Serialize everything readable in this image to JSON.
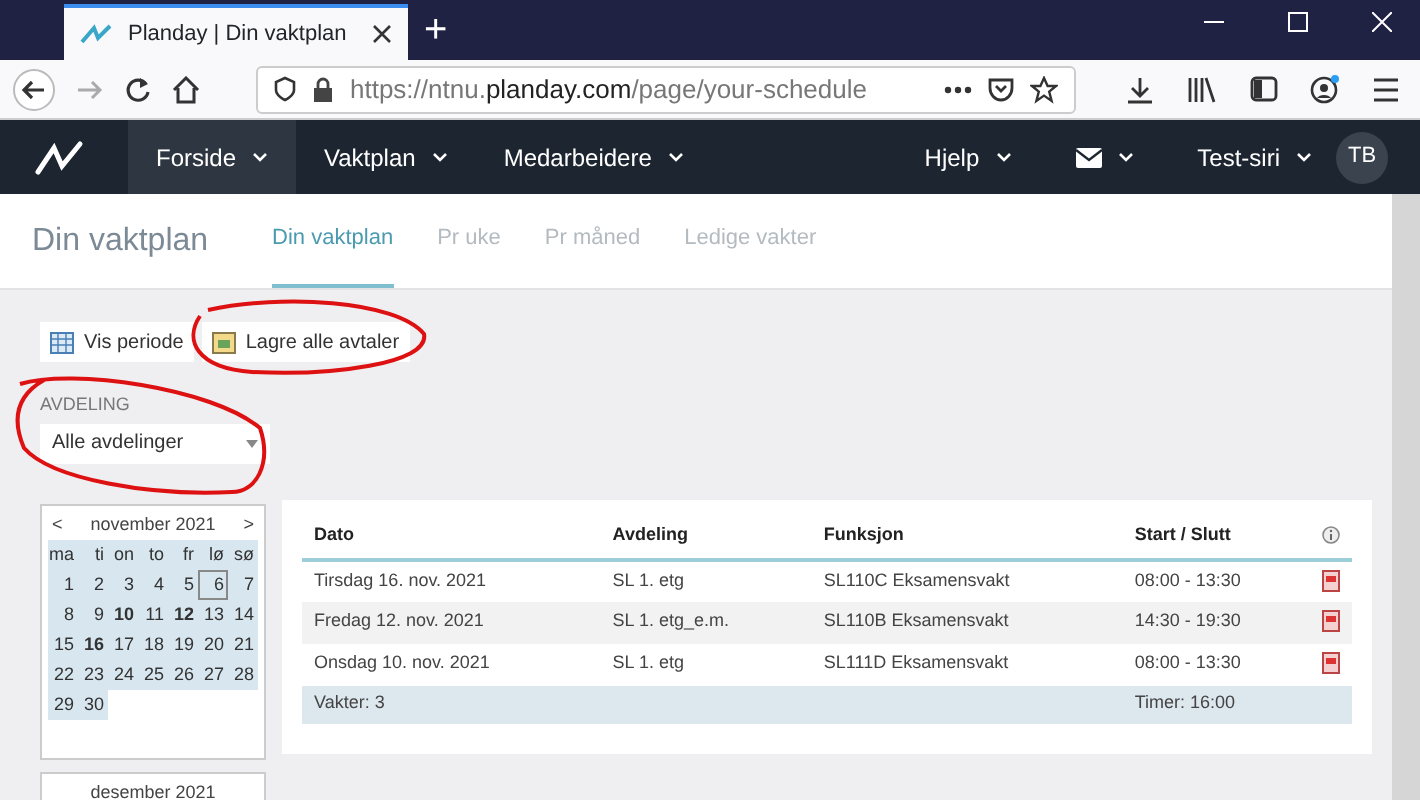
{
  "browser": {
    "tab_title": "Planday | Din vaktplan",
    "new_tab": "+",
    "url": "https://ntnu.**planday.com**/page/your-schedule"
  },
  "nav": {
    "items": [
      {
        "label": "Forside",
        "selected": true
      },
      {
        "label": "Vaktplan",
        "selected": false
      },
      {
        "label": "Medarbeidere",
        "selected": false
      }
    ],
    "help": "Hjelp",
    "user": "Test-siri",
    "avatar": "TB"
  },
  "page_title": "Din vaktplan",
  "tabs": [
    {
      "label": "Din vaktplan",
      "selected": true
    },
    {
      "label": "Pr uke",
      "selected": false
    },
    {
      "label": "Pr måned",
      "selected": false
    },
    {
      "label": "Ledige vakter",
      "selected": false
    }
  ],
  "toolbar": [
    {
      "label": "Vis periode",
      "kind": "calendar"
    },
    {
      "label": "Lagre alle avtaler",
      "kind": "save"
    }
  ],
  "filter": {
    "label": "AVDELING",
    "value": "Alle avdelinger"
  },
  "calendar": {
    "prev": "<",
    "month": "november 2021",
    "next": ">",
    "weekdays": [
      "ma",
      "ti",
      "on",
      "to",
      "fr",
      "lø",
      "sø"
    ],
    "weeks": [
      [
        {
          "day": "1",
          "has_shift": false,
          "today": false
        },
        {
          "day": "2",
          "has_shift": false,
          "today": false
        },
        {
          "day": "3",
          "has_shift": false,
          "today": false
        },
        {
          "day": "4",
          "has_shift": false,
          "today": false
        },
        {
          "day": "5",
          "has_shift": false,
          "today": false
        },
        {
          "day": "6",
          "has_shift": false,
          "today": true
        },
        {
          "day": "7",
          "has_shift": false,
          "today": false
        }
      ],
      [
        {
          "day": "8",
          "has_shift": false,
          "today": false
        },
        {
          "day": "9",
          "has_shift": false,
          "today": false
        },
        {
          "day": "10",
          "has_shift": true,
          "today": false
        },
        {
          "day": "11",
          "has_shift": false,
          "today": false
        },
        {
          "day": "12",
          "has_shift": true,
          "today": false
        },
        {
          "day": "13",
          "has_shift": false,
          "today": false
        },
        {
          "day": "14",
          "has_shift": false,
          "today": false
        }
      ],
      [
        {
          "day": "15",
          "has_shift": false,
          "today": false
        },
        {
          "day": "16",
          "has_shift": true,
          "today": false
        },
        {
          "day": "17",
          "has_shift": false,
          "today": false
        },
        {
          "day": "18",
          "has_shift": false,
          "today": false
        },
        {
          "day": "19",
          "has_shift": false,
          "today": false
        },
        {
          "day": "20",
          "has_shift": false,
          "today": false
        },
        {
          "day": "21",
          "has_shift": false,
          "today": false
        }
      ],
      [
        {
          "day": "22",
          "has_shift": false,
          "today": false
        },
        {
          "day": "23",
          "has_shift": false,
          "today": false
        },
        {
          "day": "24",
          "has_shift": false,
          "today": false
        },
        {
          "day": "25",
          "has_shift": false,
          "today": false
        },
        {
          "day": "26",
          "has_shift": false,
          "today": false
        },
        {
          "day": "27",
          "has_shift": false,
          "today": false
        },
        {
          "day": "28",
          "has_shift": false,
          "today": false
        }
      ],
      [
        {
          "day": "29",
          "has_shift": false,
          "today": false
        },
        {
          "day": "30",
          "has_shift": false,
          "today": false
        }
      ]
    ],
    "next_month": "desember 2021"
  },
  "table": {
    "columns": [
      "Dato",
      "Avdeling",
      "Funksjon",
      "Start / Slutt"
    ],
    "rows": [
      [
        "Tirsdag 16. nov. 2021",
        "SL 1. etg",
        "SL110C Eksamensvakt",
        "08:00 - 13:30"
      ],
      [
        "Fredag 12. nov. 2021",
        "SL 1. etg_e.m.",
        "SL110B Eksamensvakt",
        "14:30 - 19:30"
      ],
      [
        "Onsdag 10. nov. 2021",
        "SL 1. etg",
        "SL111D Eksamensvakt",
        "08:00 - 13:30"
      ]
    ],
    "footer": {
      "count": "Vakter: 3",
      "hours": "Timer: 16:00"
    }
  }
}
